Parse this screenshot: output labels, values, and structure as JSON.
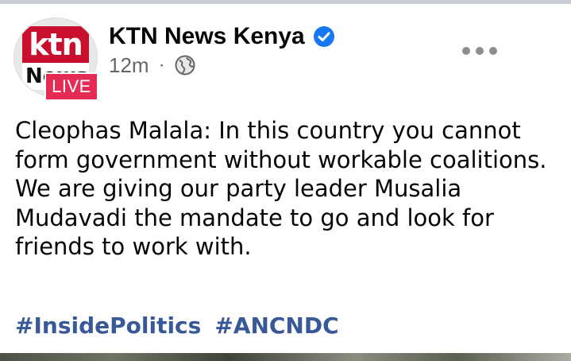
{
  "post": {
    "page_name": "KTN News Kenya",
    "avatar": {
      "logo_top": "ktn",
      "logo_bottom": "News",
      "live_badge": "LIVE"
    },
    "timestamp": "12m",
    "separator": "·",
    "audience_icon": "globe-icon",
    "verified_icon": "verified-badge-icon",
    "more_icon": "more-options-icon",
    "text": "Cleophas Malala: In this country you cannot form government without workable coalitions. We are giving our party leader Musalia Mudavadi the mandate to go and look for friends to work with.",
    "hashtags": [
      "#InsidePolitics",
      "#ANCNDC"
    ]
  },
  "colors": {
    "verified": "#1877f2",
    "live_badge": "#e42b55",
    "hashtag": "#385898",
    "meta_text": "#65676b",
    "brand_red": "#c8102e"
  }
}
